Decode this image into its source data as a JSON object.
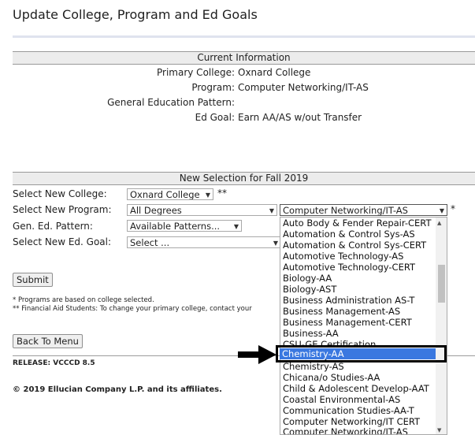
{
  "page": {
    "title": "Update College, Program and Ed Goals"
  },
  "current": {
    "heading": "Current Information",
    "rows": [
      {
        "label": "Primary College:",
        "value": "Oxnard College"
      },
      {
        "label": "Program:",
        "value": "Computer Networking/IT-AS"
      },
      {
        "label": "General Education Pattern:",
        "value": ""
      },
      {
        "label": "Ed Goal:",
        "value": "Earn AA/AS w/out Transfer"
      }
    ]
  },
  "selection": {
    "heading": "New Selection for Fall 2019",
    "college": {
      "label": "Select New College:",
      "value": "Oxnard College",
      "required": "**"
    },
    "program": {
      "label": "Select New Program:",
      "value": "All Degrees"
    },
    "program_list": {
      "value": "Computer Networking/IT-AS",
      "required": "*"
    },
    "ged": {
      "label": "Gen. Ed. Pattern:",
      "value": "Available Patterns..."
    },
    "goal": {
      "label": "Select New Ed. Goal:",
      "value": "Select ..."
    }
  },
  "dropdown_options": [
    "Auto Body & Fender Repair-CERT",
    "Automation & Control Sys-AS",
    "Automation & Control Sys-CERT",
    "Automotive Technology-AS",
    "Automotive Technology-CERT",
    "Biology-AA",
    "Biology-AST",
    "Business Administration AS-T",
    "Business Management-AS",
    "Business Management-CERT",
    "Business-AA",
    "CSU-GE Certification",
    "Chemistry-AA",
    "Chemistry-AS",
    "Chicana/o Studies-AA",
    "Child & Adolescent Develop-AAT",
    "Coastal Environmental-AS",
    "Communication Studies-AA-T",
    "Computer Networking/IT CERT",
    "Computer Networking/IT-AS"
  ],
  "highlighted_option": "Chemistry-AA",
  "buttons": {
    "submit": "Submit",
    "back": "Back To Menu"
  },
  "notes": {
    "line1": "* Programs are based on college selected.",
    "line2": "** Financial Aid Students: To change your primary college, contact your"
  },
  "footer": {
    "release": "RELEASE: VCCCD 8.5",
    "copyright": "© 2019 Ellucian Company L.P. and its affiliates."
  }
}
